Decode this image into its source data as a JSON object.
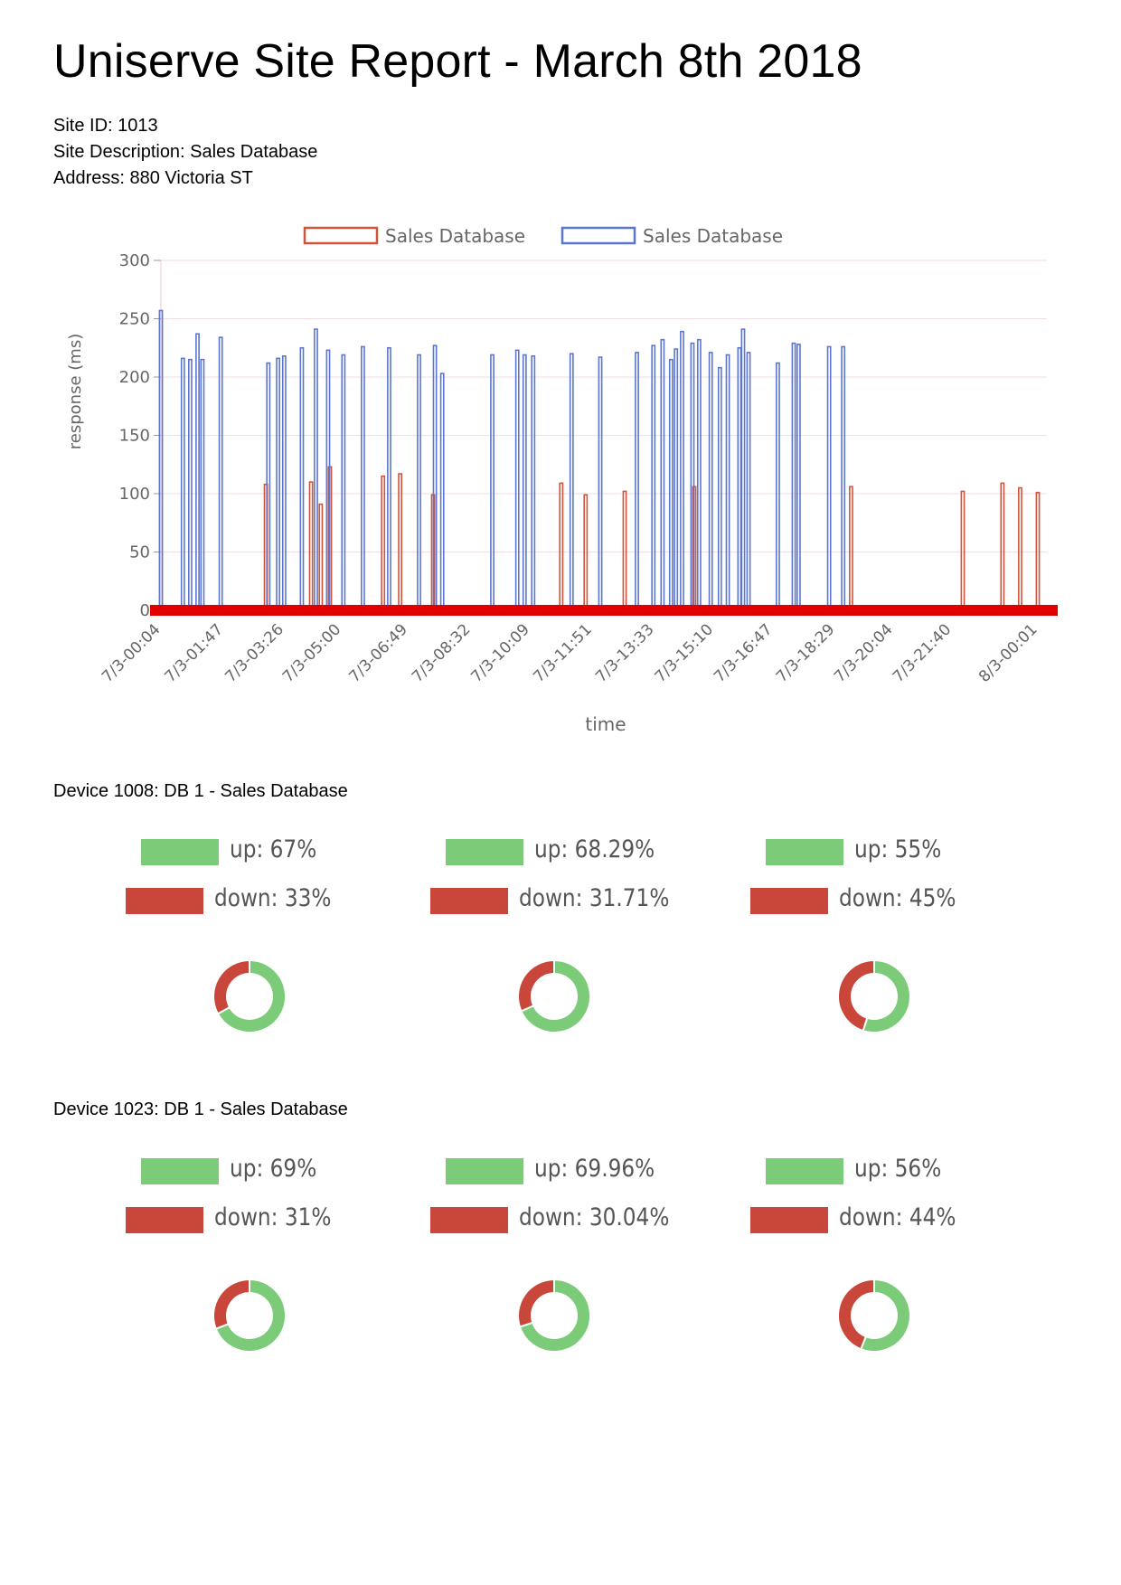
{
  "report": {
    "title": "Uniserve Site Report - March 8th 2018",
    "site_id": "Site ID: 1013",
    "site_description": "Site Description: Sales Database",
    "address": "Address: 880 Victoria ST"
  },
  "chart_data": {
    "type": "bar",
    "xlabel": "time",
    "ylabel": "response (ms)",
    "ylim": [
      0,
      300
    ],
    "yticks": [
      0,
      50,
      100,
      150,
      200,
      250,
      300
    ],
    "grid": true,
    "legend_position": "top",
    "x_tick_labels": [
      "7/3-00:04",
      "7/3-01:47",
      "7/3-03:26",
      "7/3-05:00",
      "7/3-06:49",
      "7/3-08:32",
      "7/3-10:09",
      "7/3-11:51",
      "7/3-13:33",
      "7/3-15:10",
      "7/3-16:47",
      "7/3-18:29",
      "7/3-20:04",
      "7/3-21:40",
      "8/3-00:01"
    ],
    "series": [
      {
        "name": "Sales Database",
        "color": "#d1533a",
        "points": [
          {
            "x": "7/3-02:56",
            "y": 108
          },
          {
            "x": "7/3-04:10",
            "y": 110
          },
          {
            "x": "7/3-04:26",
            "y": 91
          },
          {
            "x": "7/3-04:41",
            "y": 123
          },
          {
            "x": "7/3-06:08",
            "y": 115
          },
          {
            "x": "7/3-06:36",
            "y": 117
          },
          {
            "x": "7/3-07:30",
            "y": 99
          },
          {
            "x": "7/3-11:00",
            "y": 109
          },
          {
            "x": "7/3-11:40",
            "y": 99
          },
          {
            "x": "7/3-12:44",
            "y": 102
          },
          {
            "x": "7/3-14:38",
            "y": 106
          },
          {
            "x": "7/3-18:55",
            "y": 106
          },
          {
            "x": "7/3-21:58",
            "y": 102
          },
          {
            "x": "7/3-23:03",
            "y": 109
          },
          {
            "x": "7/3-23:32",
            "y": 105
          },
          {
            "x": "8/3-00:01",
            "y": 101
          }
        ]
      },
      {
        "name": "Sales Database",
        "color": "#5b76d0",
        "points": [
          {
            "x": "7/3-00:04",
            "y": 257
          },
          {
            "x": "7/3-00:40",
            "y": 216
          },
          {
            "x": "7/3-00:52",
            "y": 215
          },
          {
            "x": "7/3-01:04",
            "y": 237
          },
          {
            "x": "7/3-01:12",
            "y": 215
          },
          {
            "x": "7/3-01:42",
            "y": 234
          },
          {
            "x": "7/3-03:00",
            "y": 212
          },
          {
            "x": "7/3-03:16",
            "y": 216
          },
          {
            "x": "7/3-03:26",
            "y": 218
          },
          {
            "x": "7/3-03:55",
            "y": 225
          },
          {
            "x": "7/3-04:18",
            "y": 241
          },
          {
            "x": "7/3-04:38",
            "y": 223
          },
          {
            "x": "7/3-05:03",
            "y": 219
          },
          {
            "x": "7/3-05:35",
            "y": 226
          },
          {
            "x": "7/3-06:18",
            "y": 225
          },
          {
            "x": "7/3-07:07",
            "y": 219
          },
          {
            "x": "7/3-07:33",
            "y": 227
          },
          {
            "x": "7/3-07:45",
            "y": 203
          },
          {
            "x": "7/3-09:07",
            "y": 219
          },
          {
            "x": "7/3-09:48",
            "y": 223
          },
          {
            "x": "7/3-10:00",
            "y": 219
          },
          {
            "x": "7/3-10:14",
            "y": 218
          },
          {
            "x": "7/3-11:17",
            "y": 220
          },
          {
            "x": "7/3-12:04",
            "y": 217
          },
          {
            "x": "7/3-13:04",
            "y": 221
          },
          {
            "x": "7/3-13:31",
            "y": 227
          },
          {
            "x": "7/3-13:46",
            "y": 232
          },
          {
            "x": "7/3-14:00",
            "y": 215
          },
          {
            "x": "7/3-14:08",
            "y": 224
          },
          {
            "x": "7/3-14:18",
            "y": 239
          },
          {
            "x": "7/3-14:35",
            "y": 229
          },
          {
            "x": "7/3-14:46",
            "y": 232
          },
          {
            "x": "7/3-15:05",
            "y": 221
          },
          {
            "x": "7/3-15:20",
            "y": 208
          },
          {
            "x": "7/3-15:33",
            "y": 219
          },
          {
            "x": "7/3-15:52",
            "y": 225
          },
          {
            "x": "7/3-15:58",
            "y": 241
          },
          {
            "x": "7/3-16:07",
            "y": 221
          },
          {
            "x": "7/3-16:55",
            "y": 212
          },
          {
            "x": "7/3-17:21",
            "y": 229
          },
          {
            "x": "7/3-17:29",
            "y": 228
          },
          {
            "x": "7/3-18:19",
            "y": 226
          },
          {
            "x": "7/3-18:42",
            "y": 226
          }
        ]
      }
    ]
  },
  "devices": [
    {
      "title": "Device 1008: DB 1 - Sales Database",
      "donuts": [
        {
          "up_label": "up: 67%",
          "down_label": "down: 33%",
          "up": 67,
          "down": 33
        },
        {
          "up_label": "up: 68.29%",
          "down_label": "down: 31.71%",
          "up": 68.29,
          "down": 31.71
        },
        {
          "up_label": "up: 55%",
          "down_label": "down: 45%",
          "up": 55,
          "down": 45
        }
      ]
    },
    {
      "title": "Device 1023: DB 1 - Sales Database",
      "donuts": [
        {
          "up_label": "up: 69%",
          "down_label": "down: 31%",
          "up": 69,
          "down": 31
        },
        {
          "up_label": "up: 69.96%",
          "down_label": "down: 30.04%",
          "up": 69.96,
          "down": 30.04
        },
        {
          "up_label": "up: 56%",
          "down_label": "down: 44%",
          "up": 56,
          "down": 44
        }
      ]
    }
  ],
  "colors": {
    "up": "#7bcb79",
    "down": "#c9473a",
    "baseline": "#e00000",
    "grid": "#f2dde2"
  }
}
